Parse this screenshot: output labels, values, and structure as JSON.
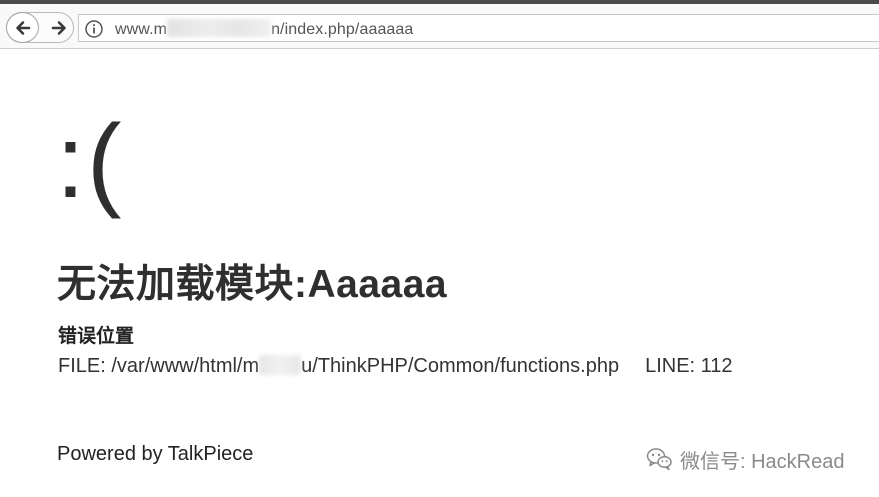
{
  "browser": {
    "url_prefix": "www.m",
    "url_suffix": "n/index.php/aaaaaa",
    "back_icon": "arrow-left-icon",
    "forward_icon": "arrow-right-icon",
    "info_icon": "info-circle-icon"
  },
  "error": {
    "face": ":(",
    "headline": "无法加载模块:Aaaaaa",
    "section_title": "错误位置",
    "file_prefix": "FILE: /var/www/html/m",
    "file_suffix": "u/ThinkPHP/Common/functions.php",
    "line_text": "LINE: 112"
  },
  "footer": {
    "powered_by": "Powered by TalkPiece"
  },
  "watermark": {
    "icon": "wechat-icon",
    "text": "微信号: HackRead"
  },
  "colors": {
    "text": "#333333",
    "chrome_bg": "#f9f9fa",
    "watermark": "#8a8a8a"
  }
}
